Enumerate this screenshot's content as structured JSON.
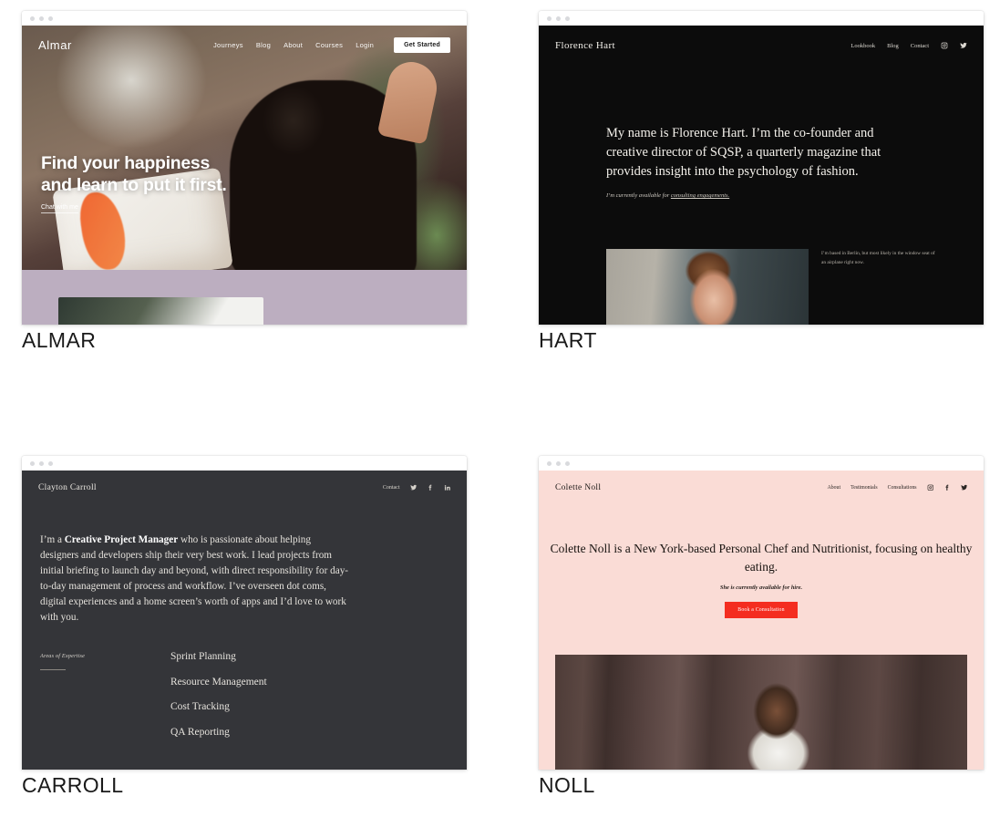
{
  "page": {
    "background": "#ffffff"
  },
  "chrome": {
    "dots": 3,
    "dot_color": "#d9dadd"
  },
  "templates": [
    {
      "id": "almar",
      "title": "ALMAR",
      "site": {
        "logo": "Almar",
        "nav": [
          "Journeys",
          "Blog",
          "About",
          "Courses",
          "Login"
        ],
        "cta": "Get Started",
        "headline": "Find your happiness and learn to put it first.",
        "headline_line1": "Find your happiness",
        "headline_line2": "and learn to put it first.",
        "link": "Chat with me",
        "band_color": "#bcaec0"
      }
    },
    {
      "id": "hart",
      "title": "HART",
      "site": {
        "logo": "Florence Hart",
        "nav": [
          "Lookbook",
          "Blog",
          "Contact"
        ],
        "social": [
          "instagram-icon",
          "twitter-icon"
        ],
        "headline": "My name is Florence Hart. I’m the co-founder and creative director of SQSP, a quarterly magazine that provides insight into the psychology of fashion.",
        "subline_prefix": "I’m currently available for ",
        "subline_link": "consulting engagements.",
        "caption": "I’m based in Berlin, but most likely in the window seat of an airplane right now.",
        "background": "#0c0c0c"
      }
    },
    {
      "id": "carroll",
      "title": "CARROLL",
      "site": {
        "logo": "Clayton Carroll",
        "nav": [
          "Contact"
        ],
        "social": [
          "twitter-icon",
          "facebook-icon",
          "linkedin-icon"
        ],
        "body_pre": "I’m a ",
        "body_bold": "Creative Project Manager",
        "body_post": " who is passionate about helping designers and developers ship their very best work. I lead projects from initial briefing to launch day and beyond, with direct responsibility for day-to-day management of process and workflow. I’ve overseen dot coms, digital experiences and a home screen’s worth of apps and I’d love to work with you.",
        "expertise_label": "Areas of Expertise",
        "expertise": [
          "Sprint Planning",
          "Resource Management",
          "Cost Tracking",
          "QA Reporting"
        ],
        "background": "#343539"
      }
    },
    {
      "id": "noll",
      "title": "NOLL",
      "site": {
        "logo": "Colette Noll",
        "nav": [
          "About",
          "Testimonials",
          "Consultations"
        ],
        "social": [
          "instagram-icon",
          "facebook-icon",
          "twitter-icon"
        ],
        "headline": "Colette Noll is a New York-based Personal Chef and Nutritionist, focusing on healthy eating.",
        "subline": "She is currently available for hire.",
        "button": "Book a Consultation",
        "background": "#fadcd6",
        "button_color": "#f42d20"
      }
    }
  ]
}
